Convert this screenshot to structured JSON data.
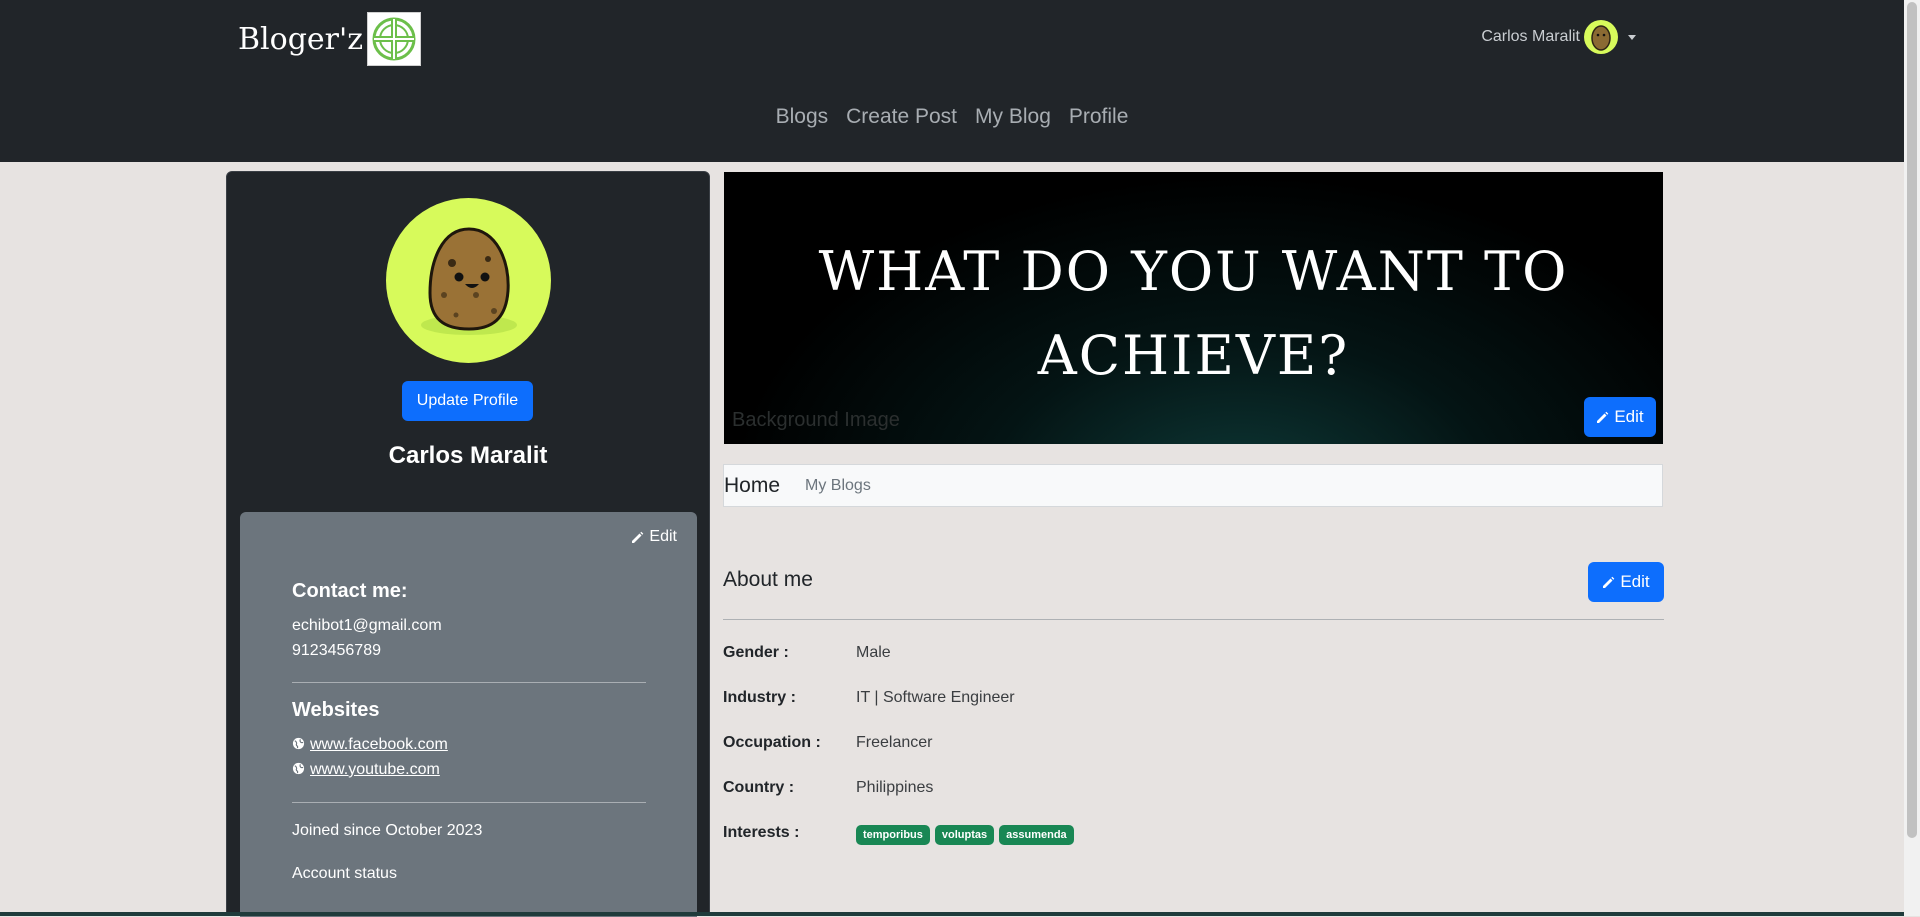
{
  "navbar": {
    "brand": "Bloger'z",
    "user_name": "Carlos Maralit",
    "links": [
      "Blogs",
      "Create Post",
      "My Blog",
      "Profile"
    ]
  },
  "profile": {
    "update_button": "Update Profile",
    "name": "Carlos Maralit",
    "edit_label": "Edit",
    "contact_heading": "Contact me:",
    "email": "echibot1@gmail.com",
    "phone": "9123456789",
    "websites_heading": "Websites",
    "websites": [
      "www.facebook.com",
      "www.youtube.com"
    ],
    "joined": "Joined since October 2023",
    "account_status": "Account status"
  },
  "banner": {
    "line1": "WHAT DO YOU WANT TO",
    "line2": "ACHIEVE?",
    "alt_text": "Background Image",
    "edit_label": "Edit"
  },
  "tabs": {
    "home": "Home",
    "my_blogs": "My Blogs"
  },
  "about": {
    "title": "About me",
    "edit_label": "Edit",
    "gender_label": "Gender :",
    "gender": "Male",
    "industry_label": "Industry :",
    "industry": "IT | Software Engineer",
    "occupation_label": "Occupation :",
    "occupation": "Freelancer",
    "country_label": "Country :",
    "country": "Philippines",
    "interests_label": "Interests :",
    "interests": [
      "temporibus",
      "voluptas",
      "assumenda"
    ]
  },
  "colors": {
    "navbar": "#212529",
    "primary": "#0d6efd",
    "badge": "#198754",
    "avatar_bg": "#d7fa5b"
  }
}
